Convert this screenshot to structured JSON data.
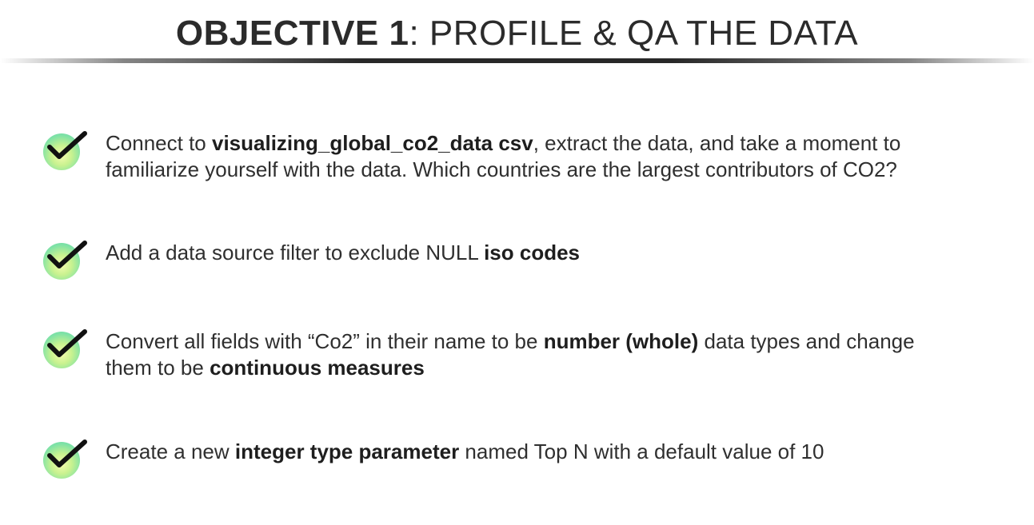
{
  "title": {
    "bold": "OBJECTIVE 1",
    "rest": ": PROFILE & QA THE DATA"
  },
  "colors": {
    "title_text": "#2b2b2b",
    "body_text": "#2f2f2f",
    "check_mark": "#111111",
    "check_disc_light": "#f6fbb0",
    "check_disc_dark": "#5fd3a8"
  },
  "icon": "checkmark-icon",
  "items": [
    {
      "p1": "Connect to ",
      "b1": "visualizing_global_co2_data csv",
      "p2": ", extract the data, and take a moment to",
      "line2": "familiarize yourself with the data. Which countries are the largest contributors of CO2?"
    },
    {
      "p1": "Add a data source filter to exclude NULL ",
      "b1": "iso codes"
    },
    {
      "p1": "Convert all fields with “Co2” in their name to be ",
      "b1": "number (whole)",
      "p2": " data types and change",
      "line2_p1": "them to be ",
      "line2_b1": "continuous measures"
    },
    {
      "p1": "Create a new ",
      "b1": "integer type parameter",
      "p2": " named Top N with a default value of 10"
    }
  ]
}
